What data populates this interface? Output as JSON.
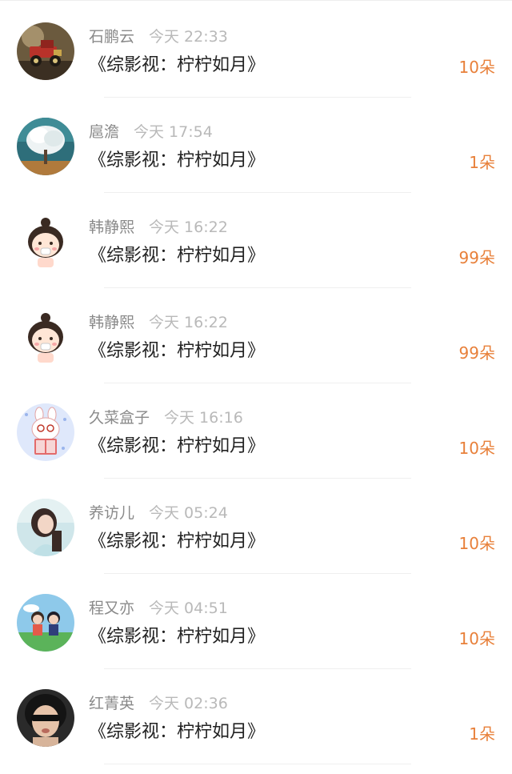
{
  "records": [
    {
      "name": "石鹏云",
      "time": "今天 22:33",
      "title": "《综影视：柠柠如月》",
      "amount": "10朵",
      "avatar_icon": "vintage-car-avatar-icon"
    },
    {
      "name": "扈澹",
      "time": "今天 17:54",
      "title": "《综影视：柠柠如月》",
      "amount": "1朵",
      "avatar_icon": "white-tree-avatar-icon"
    },
    {
      "name": "韩静熙",
      "time": "今天 16:22",
      "title": "《综影视：柠柠如月》",
      "amount": "99朵",
      "avatar_icon": "cartoon-girl-avatar-icon"
    },
    {
      "name": "韩静熙",
      "time": "今天 16:22",
      "title": "《综影视：柠柠如月》",
      "amount": "99朵",
      "avatar_icon": "cartoon-girl-avatar-icon"
    },
    {
      "name": "久菜盒子",
      "time": "今天 16:16",
      "title": "《综影视：柠柠如月》",
      "amount": "10朵",
      "avatar_icon": "cartoon-bunny-reading-avatar-icon"
    },
    {
      "name": "养访儿",
      "time": "今天 05:24",
      "title": "《综影视：柠柠如月》",
      "amount": "10朵",
      "avatar_icon": "girl-photo-avatar-icon"
    },
    {
      "name": "程又亦",
      "time": "今天 04:51",
      "title": "《综影视：柠柠如月》",
      "amount": "10朵",
      "avatar_icon": "anime-couple-avatar-icon"
    },
    {
      "name": "红菁英",
      "time": "今天 02:36",
      "title": "《综影视：柠柠如月》",
      "amount": "1朵",
      "avatar_icon": "sunglasses-person-avatar-icon"
    }
  ],
  "colors": {
    "name": "#8a8a8a",
    "time": "#b9b9b9",
    "title": "#222222",
    "amount": "#e8803a",
    "divider": "#efefef"
  }
}
